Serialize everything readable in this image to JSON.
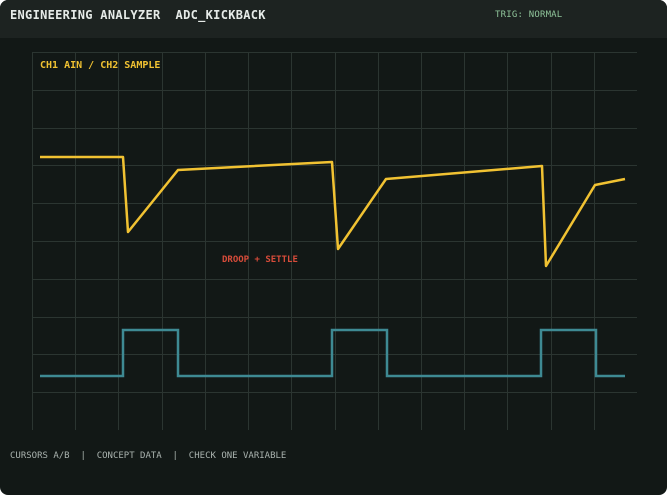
{
  "header": {
    "title": "ENGINEERING ANALYZER  ADC_KICKBACK",
    "trigger_status": "TRIG: NORMAL"
  },
  "scope": {
    "channel_label": "CH1 AIN / CH2 SAMPLE",
    "annotation": "DROOP + SETTLE",
    "grid": true
  },
  "footer": {
    "status": "CURSORS A/B  |  CONCEPT DATA  |  CHECK ONE VARIABLE"
  },
  "colors": {
    "background": "#121816",
    "header": "#1d2321",
    "grid": "#2b3531",
    "ch1_trace": "#f1c232",
    "ch2_trace": "#3e8a93",
    "annotation": "#d84c3a",
    "trigger_text": "#8fc49a"
  }
}
